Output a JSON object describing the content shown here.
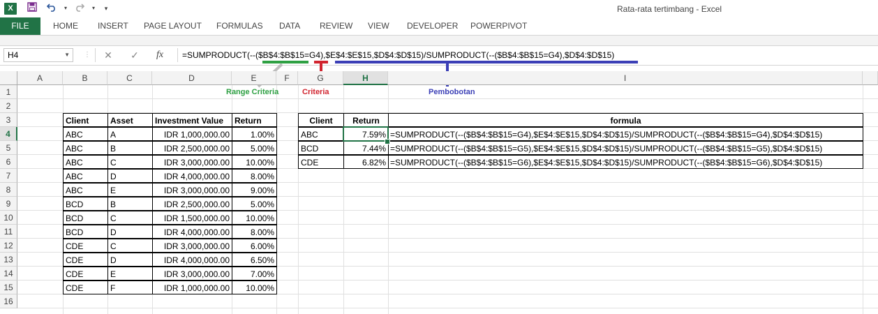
{
  "window": {
    "title": "Rata-rata tertimbang - Excel",
    "app_icon": "X"
  },
  "quick_access": {
    "icons": [
      "save-icon",
      "undo-icon",
      "redo-icon",
      "customize-icon"
    ]
  },
  "ribbon": {
    "tabs": [
      "FILE",
      "HOME",
      "INSERT",
      "PAGE LAYOUT",
      "FORMULAS",
      "DATA",
      "REVIEW",
      "VIEW",
      "DEVELOPER",
      "POWERPIVOT"
    ]
  },
  "formula_bar": {
    "name_box": "H4",
    "fx_label": "fx",
    "formula": "=SUMPRODUCT(--($B$4:$B$15=G4),$E$4:$E$15,$D$4:$D$15)/SUMPRODUCT(--($B$4:$B$15=G4),$D$4:$D$15)"
  },
  "annotations": {
    "range_criteria": "Range Criteria",
    "criteria": "Criteria",
    "pembobotan": "Pembobotan",
    "colors": {
      "range_criteria": "#2ea043",
      "criteria": "#d1242f",
      "pembobotan": "#3b3fb6",
      "gray": "#bdbdbd"
    }
  },
  "columns": [
    "A",
    "B",
    "C",
    "D",
    "E",
    "F",
    "G",
    "H",
    "I"
  ],
  "rows": [
    "1",
    "2",
    "3",
    "4",
    "5",
    "6",
    "7",
    "8",
    "9",
    "10",
    "11",
    "12",
    "13",
    "14",
    "15",
    "16"
  ],
  "selection": {
    "cell": "H4",
    "column": "H",
    "row": "4"
  },
  "source_table": {
    "headers": [
      "Client",
      "Asset",
      "Investment Value",
      "Return"
    ],
    "rows": [
      [
        "ABC",
        "A",
        "IDR 1,000,000.00",
        "1.00%"
      ],
      [
        "ABC",
        "B",
        "IDR 2,500,000.00",
        "5.00%"
      ],
      [
        "ABC",
        "C",
        "IDR 3,000,000.00",
        "10.00%"
      ],
      [
        "ABC",
        "D",
        "IDR 4,000,000.00",
        "8.00%"
      ],
      [
        "ABC",
        "E",
        "IDR 3,000,000.00",
        "9.00%"
      ],
      [
        "BCD",
        "B",
        "IDR 2,500,000.00",
        "5.00%"
      ],
      [
        "BCD",
        "C",
        "IDR 1,500,000.00",
        "10.00%"
      ],
      [
        "BCD",
        "D",
        "IDR 4,000,000.00",
        "8.00%"
      ],
      [
        "CDE",
        "C",
        "IDR 3,000,000.00",
        "6.00%"
      ],
      [
        "CDE",
        "D",
        "IDR 4,000,000.00",
        "6.50%"
      ],
      [
        "CDE",
        "E",
        "IDR 3,000,000.00",
        "7.00%"
      ],
      [
        "CDE",
        "F",
        "IDR 1,000,000.00",
        "10.00%"
      ]
    ]
  },
  "result_table": {
    "headers": [
      "Client",
      "Return",
      "formula"
    ],
    "rows": [
      [
        "ABC",
        "7.59%",
        "=SUMPRODUCT(--($B$4:$B$15=G4),$E$4:$E$15,$D$4:$D$15)/SUMPRODUCT(--($B$4:$B$15=G4),$D$4:$D$15)"
      ],
      [
        "BCD",
        "7.44%",
        "=SUMPRODUCT(--($B$4:$B$15=G5),$E$4:$E$15,$D$4:$D$15)/SUMPRODUCT(--($B$4:$B$15=G5),$D$4:$D$15)"
      ],
      [
        "CDE",
        "6.82%",
        "=SUMPRODUCT(--($B$4:$B$15=G6),$E$4:$E$15,$D$4:$D$15)/SUMPRODUCT(--($B$4:$B$15=G6),$D$4:$D$15)"
      ]
    ]
  }
}
